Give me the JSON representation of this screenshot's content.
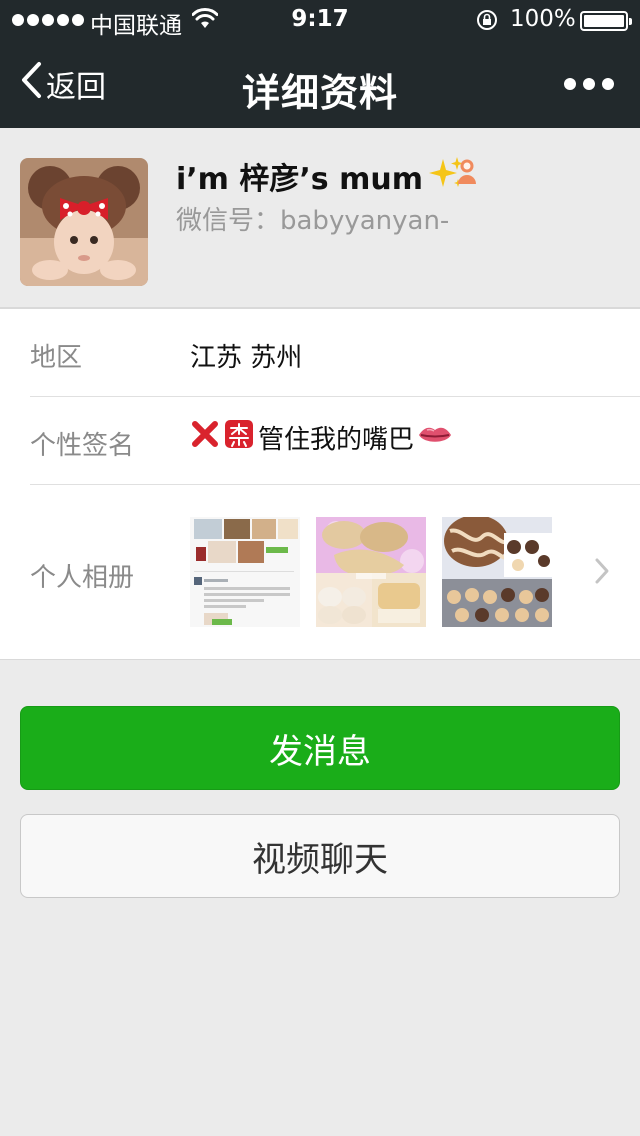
{
  "status_bar": {
    "carrier": "中国联通",
    "time": "9:17",
    "battery": "100%"
  },
  "nav": {
    "back_label": "返回",
    "title": "详细资料"
  },
  "profile": {
    "name": "i’m 梓彦’s mum",
    "wechat_id": "微信号：babyyanyan-"
  },
  "info": {
    "region_label": "地区",
    "region_value": "江苏 苏州",
    "signature_label": "个性签名",
    "signature_text": "管住我的嘴巴",
    "album_label": "个人相册"
  },
  "actions": {
    "send_message": "发消息",
    "video_chat": "视频聊天"
  },
  "colors": {
    "nav_bg": "#22292c",
    "primary_green": "#1aad19",
    "page_bg": "#ebebeb"
  }
}
